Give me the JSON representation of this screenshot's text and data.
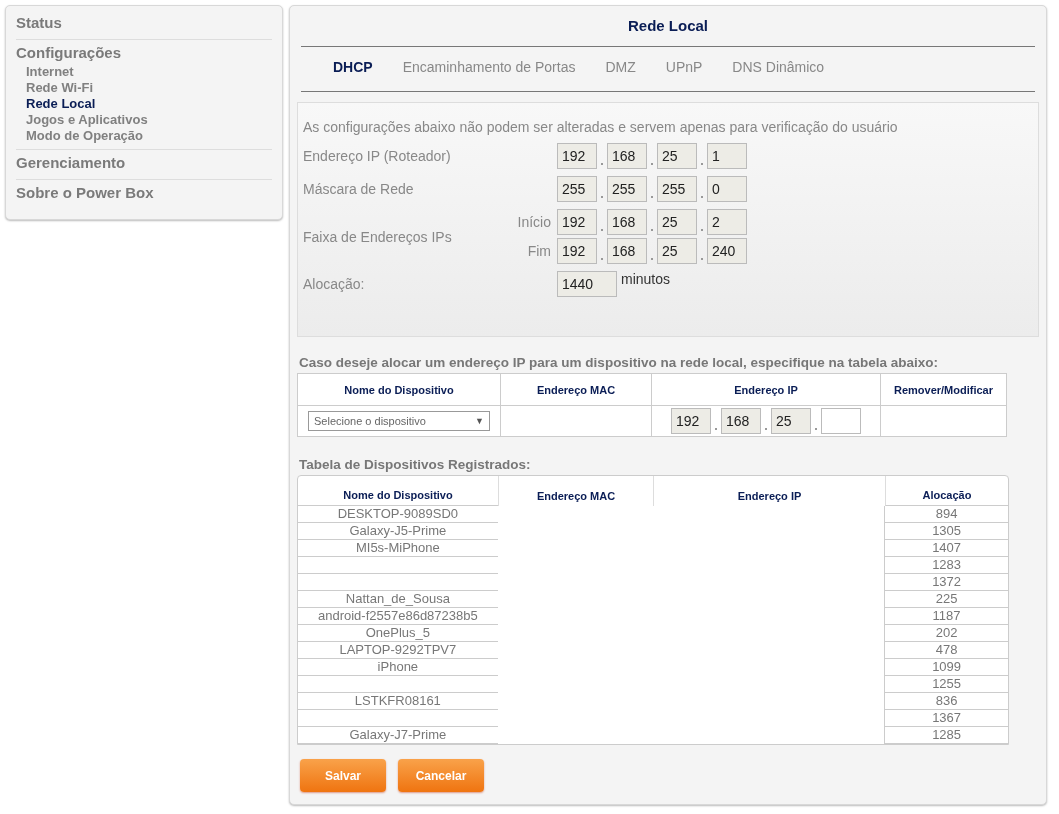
{
  "sidebar": {
    "sections": [
      {
        "label": "Status"
      },
      {
        "label": "Configurações",
        "items": [
          {
            "label": "Internet",
            "selected": false
          },
          {
            "label": "Rede Wi-Fi",
            "selected": false
          },
          {
            "label": "Rede Local",
            "selected": true
          },
          {
            "label": "Jogos e Aplicativos",
            "selected": false
          },
          {
            "label": "Modo de Operação",
            "selected": false
          }
        ]
      },
      {
        "label": "Gerenciamento"
      },
      {
        "label": "Sobre o Power Box"
      }
    ]
  },
  "title": "Rede Local",
  "tabs": [
    {
      "label": "DHCP",
      "selected": true
    },
    {
      "label": "Encaminhamento de Portas",
      "selected": false
    },
    {
      "label": "DMZ",
      "selected": false
    },
    {
      "label": "UPnP",
      "selected": false
    },
    {
      "label": "DNS Dinâmico",
      "selected": false
    }
  ],
  "info": {
    "note": "As configurações abaixo não podem ser alteradas e servem apenas para verificação do usuário",
    "router_ip": {
      "label": "Endereço IP (Roteador)",
      "octets": [
        "192",
        "168",
        "25",
        "1"
      ]
    },
    "netmask": {
      "label": "Máscara de Rede",
      "octets": [
        "255",
        "255",
        "255",
        "0"
      ]
    },
    "range": {
      "label": "Faixa de Endereços IPs",
      "start_label": "Início",
      "start": [
        "192",
        "168",
        "25",
        "2"
      ],
      "end_label": "Fim",
      "end": [
        "192",
        "168",
        "25",
        "240"
      ]
    },
    "lease": {
      "label": "Alocação:",
      "value": "1440",
      "unit": "minutos"
    }
  },
  "reserve": {
    "heading": "Caso deseje alocar um endereço IP para um dispositivo na rede local, especifique na tabela abaixo:",
    "columns": [
      "Nome do Dispositivo",
      "Endereço MAC",
      "Endereço IP",
      "Remover/Modificar"
    ],
    "device_select": {
      "value": "Selecione o dispositivo",
      "caret": "▼"
    },
    "ip_octets": [
      {
        "value": "192",
        "disabled": true
      },
      {
        "value": "168",
        "disabled": true
      },
      {
        "value": "25",
        "disabled": true
      },
      {
        "disabled": false
      }
    ]
  },
  "registered": {
    "heading": "Tabela de Dispositivos Registrados:",
    "columns": [
      "Nome do Dispositivo",
      "Endereço MAC",
      "Endereço IP",
      "Alocação"
    ],
    "rows": [
      {
        "name": "DESKTOP-9089SD0",
        "lease": "894"
      },
      {
        "name": "Galaxy-J5-Prime",
        "lease": "1305"
      },
      {
        "name": "MI5s-MiPhone",
        "lease": "1407"
      },
      {
        "lease": "1283"
      },
      {
        "lease": "1372"
      },
      {
        "name": "Nattan_de_Sousa",
        "lease": "225"
      },
      {
        "name": "android-f2557e86d87238b5",
        "lease": "1187"
      },
      {
        "name": "OnePlus_5",
        "lease": "202"
      },
      {
        "name": "LAPTOP-9292TPV7",
        "lease": "478"
      },
      {
        "name": "iPhone",
        "lease": "1099"
      },
      {
        "lease": "1255"
      },
      {
        "name": "LSTKFR08161",
        "lease": "836"
      },
      {
        "lease": "1367"
      },
      {
        "name": "Galaxy-J7-Prime",
        "lease": "1285"
      }
    ]
  },
  "buttons": [
    "Salvar",
    "Cancelar"
  ]
}
